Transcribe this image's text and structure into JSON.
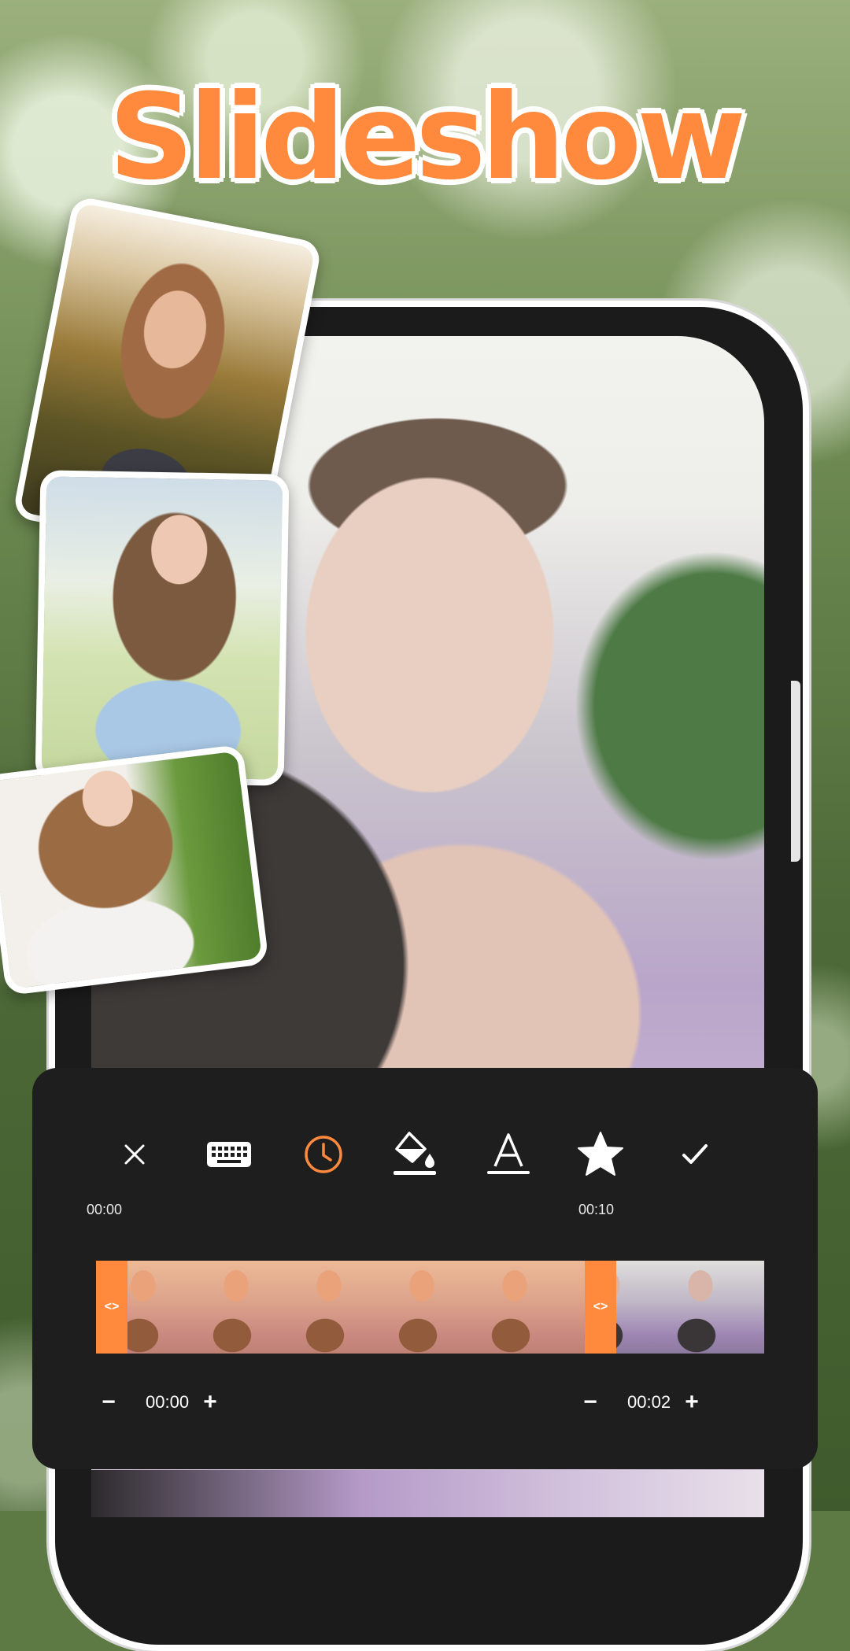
{
  "title": "Slideshow",
  "toolbar": {
    "icons": [
      "close-icon",
      "keyboard-icon",
      "clock-icon",
      "fill-color-icon",
      "text-style-icon",
      "star-icon",
      "check-icon"
    ],
    "active": "clock-icon",
    "accent_color": "#ff8a3d"
  },
  "timeline": {
    "start_label": "00:00",
    "mark_label": "00:10",
    "handle_glyph": "<>"
  },
  "controls": {
    "left": {
      "minus": "−",
      "value": "00:00",
      "plus": "+"
    },
    "right": {
      "minus": "−",
      "value": "00:02",
      "plus": "+"
    }
  }
}
